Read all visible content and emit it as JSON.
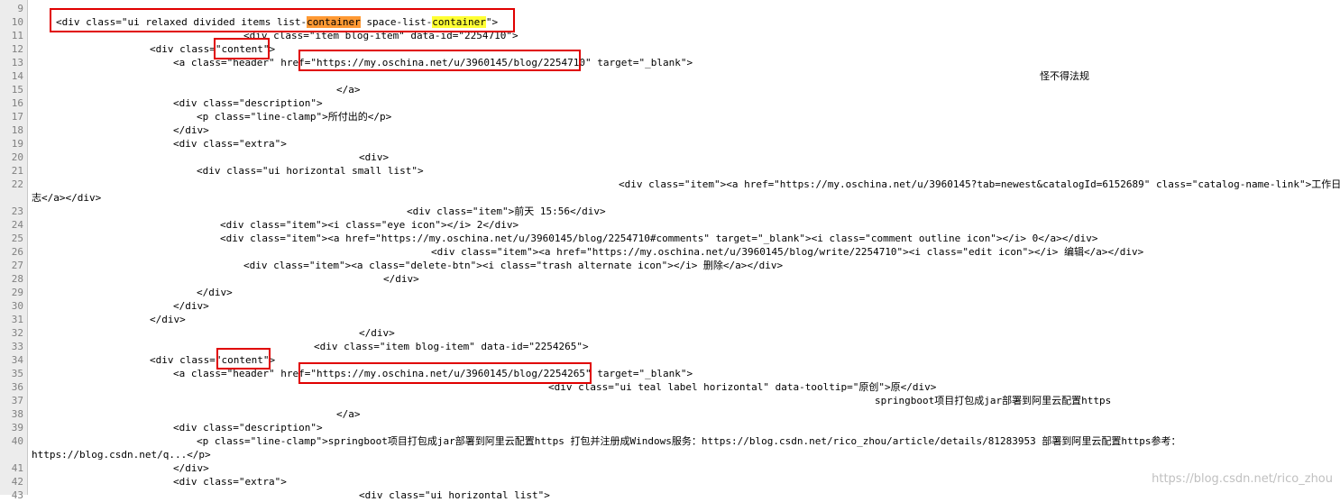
{
  "editor": {
    "lines": [
      {
        "n": "9",
        "text": ""
      },
      {
        "n": "10",
        "text": "<div class=\"ui relaxed divided items list-",
        "hl1": "container",
        "mid": " space-list-",
        "hl2": "container",
        "end": "\">"
      },
      {
        "n": "11",
        "text": "<div class=\"item blog-item\" data-id=\"2254710\">"
      },
      {
        "n": "12",
        "text": "<div class=\"content\">"
      },
      {
        "n": "13",
        "text": "<a class=\"header\" href=\"https://my.oschina.net/u/3960145/blog/2254710\" target=\"_blank\">"
      },
      {
        "n": "14",
        "text": ""
      },
      {
        "n": "15",
        "text": "</a>"
      },
      {
        "n": "16",
        "text": "<div class=\"description\">"
      },
      {
        "n": "17",
        "text": "<p class=\"line-clamp\">所付出的</p>"
      },
      {
        "n": "18",
        "text": "</div>"
      },
      {
        "n": "19",
        "text": "<div class=\"extra\">"
      },
      {
        "n": "20",
        "text": "<div>"
      },
      {
        "n": "21",
        "text": "<div class=\"ui horizontal small list\">"
      },
      {
        "n": "22",
        "text": "<div class=\"item\"><a href=\"https://my.oschina.net/u/3960145?tab=newest&catalogId=6152689\" class=\"catalog-name-link\">工作日"
      },
      {
        "n": "",
        "text": "志</a></div>"
      },
      {
        "n": "23",
        "text": "<div class=\"item\">前天 15:56</div>"
      },
      {
        "n": "24",
        "text": "<div class=\"item\"><i class=\"eye icon\"></i> 2</div>"
      },
      {
        "n": "25",
        "text": "<div class=\"item\"><a href=\"https://my.oschina.net/u/3960145/blog/2254710#comments\" target=\"_blank\"><i class=\"comment outline icon\"></i> 0</a></div>"
      },
      {
        "n": "26",
        "text": "<div class=\"item\"><a href=\"https://my.oschina.net/u/3960145/blog/write/2254710\"><i class=\"edit icon\"></i> 编辑</a></div>"
      },
      {
        "n": "27",
        "text": "<div class=\"item\"><a class=\"delete-btn\"><i class=\"trash alternate icon\"></i> 删除</a></div>"
      },
      {
        "n": "28",
        "text": "</div>"
      },
      {
        "n": "29",
        "text": "</div>"
      },
      {
        "n": "30",
        "text": "</div>"
      },
      {
        "n": "31",
        "text": "</div>"
      },
      {
        "n": "32",
        "text": "</div>"
      },
      {
        "n": "33",
        "text": "<div class=\"item blog-item\" data-id=\"2254265\">"
      },
      {
        "n": "34",
        "text": "<div class=\"content\">"
      },
      {
        "n": "35",
        "text": "<a class=\"header\" href=\"https://my.oschina.net/u/3960145/blog/2254265\" target=\"_blank\">"
      },
      {
        "n": "36",
        "text": "<div class=\"ui teal label horizontal\" data-tooltip=\"原创\">原</div>"
      },
      {
        "n": "37",
        "text": ""
      },
      {
        "n": "38",
        "text": "</a>"
      },
      {
        "n": "39",
        "text": "<div class=\"description\">"
      },
      {
        "n": "40",
        "text": "<p class=\"line-clamp\">springboot项目打包成jar部署到阿里云配置https 打包并注册成Windows服务：https://blog.csdn.net/rico_zhou/article/details/81283953 部署到阿里云配置https参考："
      },
      {
        "n": "",
        "text": "https://blog.csdn.net/q...</p>"
      },
      {
        "n": "41",
        "text": "</div>"
      },
      {
        "n": "42",
        "text": "<div class=\"extra\">"
      },
      {
        "n": "43",
        "text": "<div class=\"ui horizontal list\">"
      }
    ],
    "float_texts": {
      "title_14": "怪不得法规",
      "title_37": "springboot项目打包成jar部署到阿里云配置https"
    },
    "watermark": "https://blog.csdn.net/rico_zhou"
  },
  "colors": {
    "highlight_orange": "#ff9933",
    "highlight_yellow": "#ffff33",
    "annotation_red": "#e00000"
  }
}
